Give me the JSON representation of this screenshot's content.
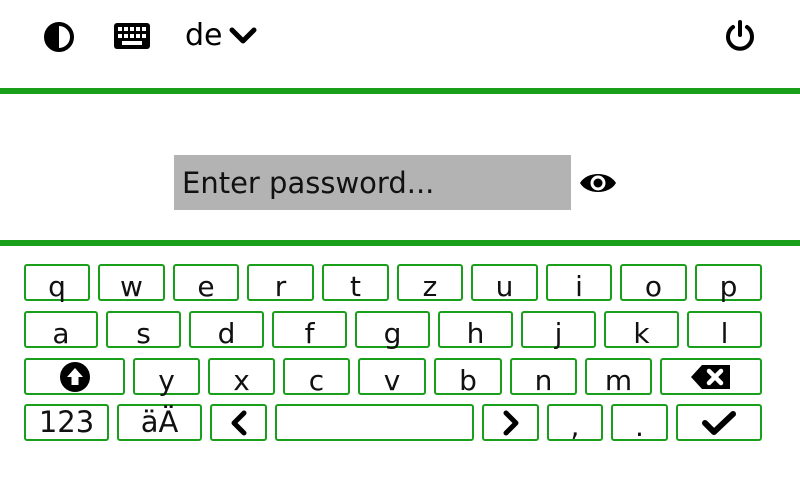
{
  "topbar": {
    "contrast_icon": "contrast-icon",
    "keyboard_icon": "keyboard-icon",
    "language": "de",
    "language_chevron_icon": "chevron-down-icon",
    "power_icon": "power-icon"
  },
  "password": {
    "placeholder": "Enter password...",
    "value": "",
    "toggle_icon": "eye-icon"
  },
  "keyboard": {
    "row1": [
      "q",
      "w",
      "e",
      "r",
      "t",
      "z",
      "u",
      "i",
      "o",
      "p"
    ],
    "row2": [
      "a",
      "s",
      "d",
      "f",
      "g",
      "h",
      "j",
      "k",
      "l"
    ],
    "row3": [
      "y",
      "x",
      "c",
      "v",
      "b",
      "n",
      "m"
    ],
    "row4": {
      "numbers_label": "123",
      "umlaut_label": "äÄ",
      "comma_label": ",",
      "period_label": "."
    },
    "shift_icon": "shift-icon",
    "backspace_icon": "backspace-icon",
    "left_icon": "chevron-left-icon",
    "right_icon": "chevron-right-icon",
    "confirm_icon": "checkmark-icon"
  },
  "colors": {
    "accent": "#1a9f1a",
    "field_bg": "#b3b3b3"
  }
}
